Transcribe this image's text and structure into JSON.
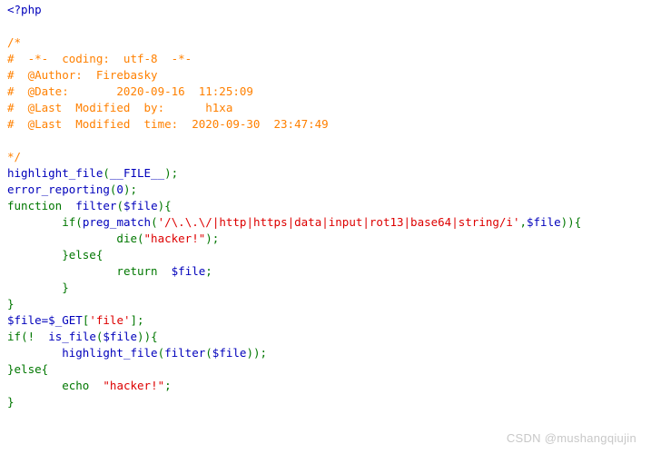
{
  "page": {
    "background": "#ffffff",
    "language": "php",
    "renderer": "highlight_file"
  },
  "palette": {
    "keyword_green": "#007700",
    "identifier_blue": "#0000BB",
    "string_red": "#DD0000",
    "comment_orange": "#FF8000",
    "watermark_gray": "#c8c8c8"
  },
  "code": {
    "lines": [
      {
        "id": 1,
        "tokens": [
          {
            "t": "<?php",
            "c": "blue"
          }
        ]
      },
      {
        "id": 2,
        "tokens": []
      },
      {
        "id": 3,
        "tokens": [
          {
            "t": "/*",
            "c": "orange"
          }
        ]
      },
      {
        "id": 4,
        "tokens": [
          {
            "t": "#  -*-  coding:  utf-8  -*-",
            "c": "orange"
          }
        ]
      },
      {
        "id": 5,
        "tokens": [
          {
            "t": "#  @Author:  Firebasky",
            "c": "orange"
          }
        ]
      },
      {
        "id": 6,
        "tokens": [
          {
            "t": "#  @Date:       2020-09-16  11:25:09",
            "c": "orange"
          }
        ]
      },
      {
        "id": 7,
        "tokens": [
          {
            "t": "#  @Last  Modified  by:      h1xa",
            "c": "orange"
          }
        ]
      },
      {
        "id": 8,
        "tokens": [
          {
            "t": "#  @Last  Modified  time:  2020-09-30  23:47:49",
            "c": "orange"
          }
        ]
      },
      {
        "id": 9,
        "tokens": []
      },
      {
        "id": 10,
        "tokens": [
          {
            "t": "*/",
            "c": "orange"
          }
        ]
      },
      {
        "id": 11,
        "tokens": [
          {
            "t": "highlight_file",
            "c": "blue"
          },
          {
            "t": "(",
            "c": "green"
          },
          {
            "t": "__FILE__",
            "c": "blue"
          },
          {
            "t": ")",
            "c": "green"
          },
          {
            "t": ";",
            "c": "green"
          }
        ]
      },
      {
        "id": 12,
        "tokens": [
          {
            "t": "error_reporting",
            "c": "blue"
          },
          {
            "t": "(",
            "c": "green"
          },
          {
            "t": "0",
            "c": "blue"
          },
          {
            "t": ")",
            "c": "green"
          },
          {
            "t": ";",
            "c": "green"
          }
        ]
      },
      {
        "id": 13,
        "tokens": [
          {
            "t": "function",
            "c": "green"
          },
          {
            "t": "  ",
            "c": "green"
          },
          {
            "t": "filter",
            "c": "blue"
          },
          {
            "t": "(",
            "c": "green"
          },
          {
            "t": "$file",
            "c": "blue"
          },
          {
            "t": ")",
            "c": "green"
          },
          {
            "t": "{",
            "c": "green"
          }
        ]
      },
      {
        "id": 14,
        "tokens": [
          {
            "t": "        ",
            "c": "green"
          },
          {
            "t": "if",
            "c": "green"
          },
          {
            "t": "(",
            "c": "green"
          },
          {
            "t": "preg_match",
            "c": "blue"
          },
          {
            "t": "(",
            "c": "green"
          },
          {
            "t": "'/\\.\\.\\/|http|https|data|input|rot13|base64|string/i'",
            "c": "red"
          },
          {
            "t": ",",
            "c": "green"
          },
          {
            "t": "$file",
            "c": "blue"
          },
          {
            "t": ")",
            "c": "green"
          },
          {
            "t": ")",
            "c": "green"
          },
          {
            "t": "{",
            "c": "green"
          }
        ]
      },
      {
        "id": 15,
        "tokens": [
          {
            "t": "                ",
            "c": "green"
          },
          {
            "t": "die",
            "c": "green"
          },
          {
            "t": "(",
            "c": "green"
          },
          {
            "t": "\"hacker!\"",
            "c": "red"
          },
          {
            "t": ")",
            "c": "green"
          },
          {
            "t": ";",
            "c": "green"
          }
        ]
      },
      {
        "id": 16,
        "tokens": [
          {
            "t": "        }else{",
            "c": "green"
          }
        ]
      },
      {
        "id": 17,
        "tokens": [
          {
            "t": "                ",
            "c": "green"
          },
          {
            "t": "return",
            "c": "green"
          },
          {
            "t": "  ",
            "c": "green"
          },
          {
            "t": "$file",
            "c": "blue"
          },
          {
            "t": ";",
            "c": "green"
          }
        ]
      },
      {
        "id": 18,
        "tokens": [
          {
            "t": "        }",
            "c": "green"
          }
        ]
      },
      {
        "id": 19,
        "tokens": [
          {
            "t": "}",
            "c": "green"
          }
        ]
      },
      {
        "id": 20,
        "tokens": [
          {
            "t": "$file",
            "c": "blue"
          },
          {
            "t": "=",
            "c": "blue"
          },
          {
            "t": "$_GET",
            "c": "blue"
          },
          {
            "t": "[",
            "c": "green"
          },
          {
            "t": "'file'",
            "c": "red"
          },
          {
            "t": "]",
            "c": "green"
          },
          {
            "t": ";",
            "c": "green"
          }
        ]
      },
      {
        "id": 21,
        "tokens": [
          {
            "t": "if",
            "c": "green"
          },
          {
            "t": "(!",
            "c": "green"
          },
          {
            "t": "  ",
            "c": "green"
          },
          {
            "t": "is_file",
            "c": "blue"
          },
          {
            "t": "(",
            "c": "green"
          },
          {
            "t": "$file",
            "c": "blue"
          },
          {
            "t": ")",
            "c": "green"
          },
          {
            "t": ")",
            "c": "green"
          },
          {
            "t": "{",
            "c": "green"
          }
        ]
      },
      {
        "id": 22,
        "tokens": [
          {
            "t": "        ",
            "c": "green"
          },
          {
            "t": "highlight_file",
            "c": "blue"
          },
          {
            "t": "(",
            "c": "green"
          },
          {
            "t": "filter",
            "c": "blue"
          },
          {
            "t": "(",
            "c": "green"
          },
          {
            "t": "$file",
            "c": "blue"
          },
          {
            "t": ")",
            "c": "green"
          },
          {
            "t": ")",
            "c": "green"
          },
          {
            "t": ";",
            "c": "green"
          }
        ]
      },
      {
        "id": 23,
        "tokens": [
          {
            "t": "}else{",
            "c": "green"
          }
        ]
      },
      {
        "id": 24,
        "tokens": [
          {
            "t": "        ",
            "c": "green"
          },
          {
            "t": "echo",
            "c": "green"
          },
          {
            "t": "  ",
            "c": "green"
          },
          {
            "t": "\"hacker!\"",
            "c": "red"
          },
          {
            "t": ";",
            "c": "green"
          }
        ]
      },
      {
        "id": 25,
        "tokens": [
          {
            "t": "}",
            "c": "green"
          }
        ]
      }
    ]
  },
  "watermark": {
    "text": "CSDN @mushangqiujin"
  }
}
